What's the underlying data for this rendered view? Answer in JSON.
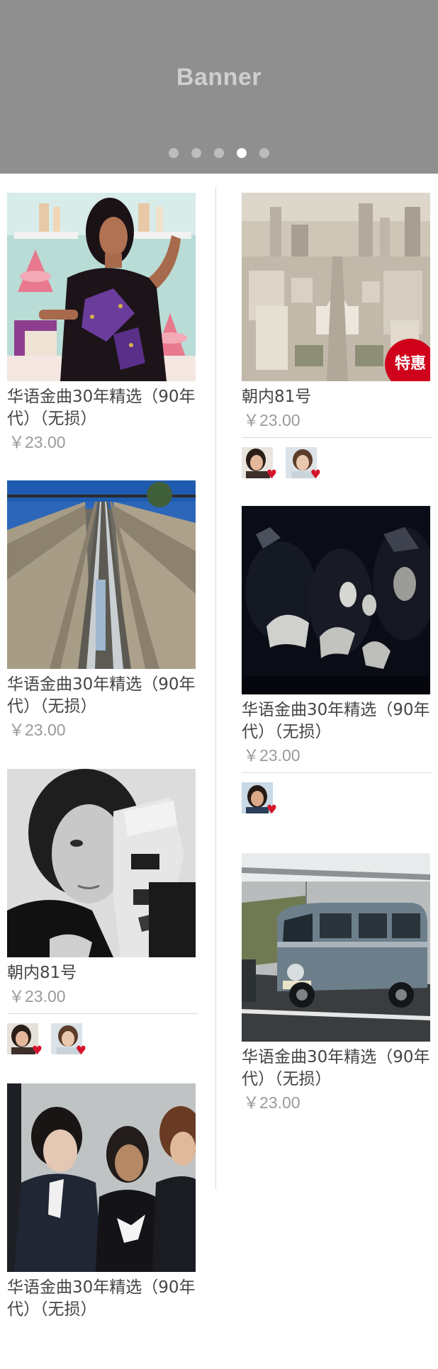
{
  "banner": {
    "title": "Banner",
    "dots": [
      false,
      false,
      false,
      true,
      false
    ]
  },
  "products": [
    {
      "title": "华语金曲30年精选（90年代）（无损）",
      "price": "￥23.00",
      "image": "fashion-woman-macarons-image"
    },
    {
      "title": "朝内81号",
      "price": "￥23.00",
      "image": "city-aerial-image",
      "badge": "特惠",
      "likers": [
        "liker-avatar-1",
        "liker-avatar-2"
      ]
    },
    {
      "title": "华语金曲30年精选（90年代）（无损）",
      "price": "￥23.00",
      "image": "railway-tracks-image"
    },
    {
      "title": "华语金曲30年精选（90年代）（无损）",
      "price": "￥23.00",
      "image": "metal-band-image",
      "likers": [
        "liker-avatar-3"
      ]
    },
    {
      "title": "朝内81号",
      "price": "￥23.00",
      "image": "tattooed-woman-portrait-image",
      "likers": [
        "liker-avatar-4",
        "liker-avatar-5"
      ]
    },
    {
      "title": "华语金曲30年精选（90年代）（无损）",
      "price": "￥23.00",
      "image": "vw-van-image"
    },
    {
      "title": "华语金曲30年精选（90年代）（无损）",
      "image": "band-group-image"
    }
  ],
  "icons": {
    "heart": "heart-icon"
  },
  "colors": {
    "banner_bg": "#8f8f8f",
    "badge_red": "#d0021b",
    "heart_red": "#d5142b",
    "price_gray": "#9a9a9a"
  }
}
